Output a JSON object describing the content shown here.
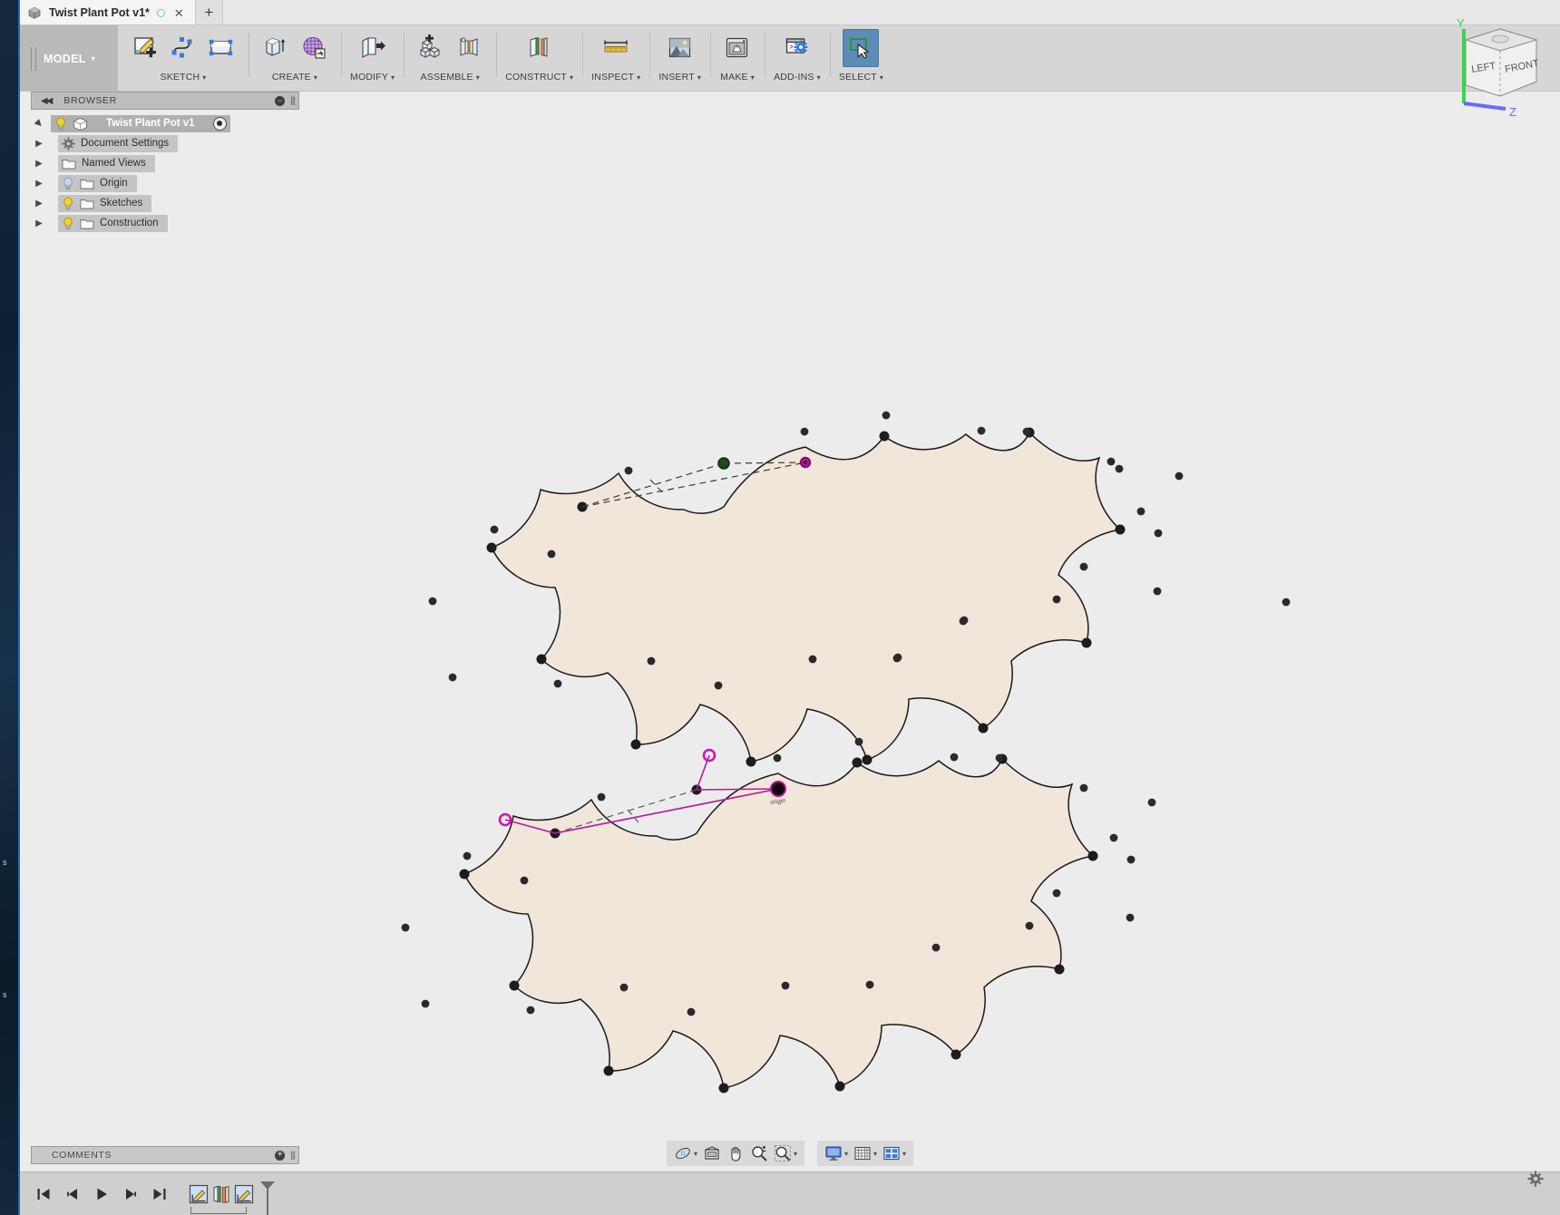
{
  "window": {
    "tab": {
      "title": "Twist Plant Pot v1*",
      "doc_icon": "cube-icon",
      "status_dot": "unsaved-indicator",
      "close_label": "✕",
      "new_tab_label": "+"
    }
  },
  "ribbon": {
    "workspace": {
      "label": "MODEL",
      "caret": "▾"
    },
    "groups": [
      {
        "name": "sketch",
        "label": "SKETCH",
        "caret": "▾",
        "buttons": [
          "create-sketch-icon",
          "spline-icon",
          "rectangle-icon"
        ]
      },
      {
        "name": "create",
        "label": "CREATE",
        "caret": "▾",
        "buttons": [
          "extrude-icon",
          "mesh-create-icon"
        ]
      },
      {
        "name": "modify",
        "label": "MODIFY",
        "caret": "▾",
        "buttons": [
          "press-pull-icon"
        ]
      },
      {
        "name": "assemble",
        "label": "ASSEMBLE",
        "caret": "▾",
        "buttons": [
          "new-component-icon",
          "joint-icon"
        ]
      },
      {
        "name": "construct",
        "label": "CONSTRUCT",
        "caret": "▾",
        "buttons": [
          "offset-plane-icon"
        ]
      },
      {
        "name": "inspect",
        "label": "INSPECT",
        "caret": "▾",
        "buttons": [
          "measure-icon"
        ]
      },
      {
        "name": "insert",
        "label": "INSERT",
        "caret": "▾",
        "buttons": [
          "insert-image-icon"
        ]
      },
      {
        "name": "make",
        "label": "MAKE",
        "caret": "▾",
        "buttons": [
          "3d-print-icon"
        ]
      },
      {
        "name": "addins",
        "label": "ADD-INS",
        "caret": "▾",
        "buttons": [
          "scripts-addins-icon"
        ]
      },
      {
        "name": "select",
        "label": "SELECT",
        "caret": "▾",
        "buttons": [
          "select-cursor-icon"
        ],
        "active": true
      }
    ]
  },
  "browser": {
    "header": {
      "collapse_icon": "double-left-arrow-icon",
      "title": "BROWSER",
      "minimize_icon": "minimize-icon",
      "resize_icon": "resize-grip-icon"
    },
    "root": {
      "label": "Twist Plant Pot v1",
      "expanded": true,
      "visibility_icon": "lightbulb-on-icon",
      "type_icon": "component-icon",
      "activate_icon": "radio-active-icon"
    },
    "items": [
      {
        "label": "Document Settings",
        "icon": "gear-icon",
        "bulb": "none",
        "expanded": false
      },
      {
        "label": "Named Views",
        "icon": "folder-icon",
        "bulb": "none",
        "expanded": false
      },
      {
        "label": "Origin",
        "icon": "folder-icon",
        "bulb": "off",
        "expanded": false
      },
      {
        "label": "Sketches",
        "icon": "folder-icon",
        "bulb": "on",
        "expanded": false
      },
      {
        "label": "Construction",
        "icon": "folder-icon",
        "bulb": "on",
        "expanded": false
      }
    ]
  },
  "viewcube": {
    "faces": [
      "LEFT",
      "FRONT"
    ],
    "axes": [
      {
        "label": "Y",
        "color": "#3fd44f"
      },
      {
        "label": "Z",
        "color": "#6a6aff"
      }
    ]
  },
  "canvas": {
    "sketch_fill": "#f0e6da",
    "sketch_stroke": "#1a1a1a",
    "point_color": "#1c1c1c",
    "dim_color": "#3a3a3a",
    "selected_color": "#b5179e",
    "selected_point_color": "#1e4620",
    "origin_label": "origin",
    "profiles": [
      {
        "name": "top-twisted-profile",
        "lobes": 12,
        "note": "construction dimension lines dashed"
      },
      {
        "name": "bottom-twisted-profile",
        "lobes": 12,
        "note": "selected magenta dimension lines"
      }
    ]
  },
  "navbar": {
    "groups": [
      {
        "name": "view-controls",
        "buttons": [
          "orbit-icon",
          "orbit-dropdown",
          "look-at-icon",
          "pan-icon",
          "zoom-icon",
          "zoom-window-icon",
          "zoom-dropdown"
        ]
      },
      {
        "name": "display-controls",
        "buttons": [
          "display-settings-icon",
          "display-dropdown",
          "grid-snap-icon",
          "grid-dropdown",
          "viewports-icon",
          "viewports-dropdown"
        ]
      }
    ]
  },
  "comments": {
    "title": "COMMENTS",
    "add_icon": "add-comment-icon",
    "resize_icon": "resize-grip-icon"
  },
  "timeline": {
    "controls": [
      "go-to-beginning-icon",
      "step-back-icon",
      "play-icon",
      "step-forward-icon",
      "go-to-end-icon"
    ],
    "features": [
      "sketch-feature-icon",
      "offset-plane-feature-icon",
      "sketch-feature-icon"
    ],
    "marker": "timeline-marker",
    "settings_icon": "timeline-settings-gear-icon"
  }
}
